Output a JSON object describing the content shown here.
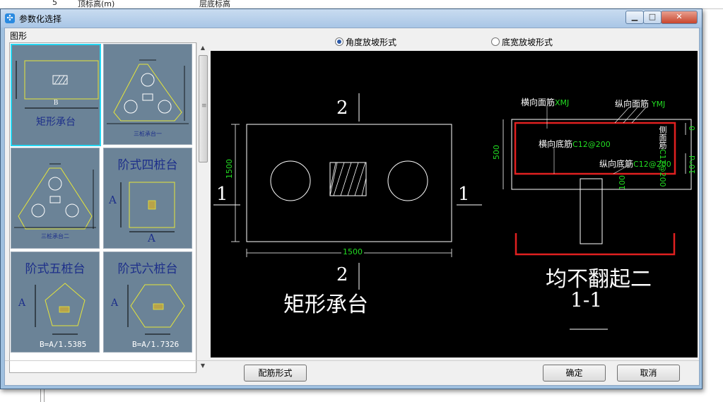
{
  "background_app": {
    "row_number": "5",
    "col1_text": "顶标高(m)",
    "col2_text": "层底标高"
  },
  "window": {
    "title": "参数化选择",
    "minimize_symbol": "▁",
    "maximize_symbol": "□",
    "close_symbol": "✕"
  },
  "left_panel": {
    "label": "图形",
    "thumbnails": [
      {
        "caption": "矩形承台",
        "dim_label": "B"
      },
      {
        "caption": "三桩承台一"
      },
      {
        "caption": "三桩承台二"
      },
      {
        "caption": "阶式四桩台",
        "dim_a": "A",
        "dim_b": "A"
      },
      {
        "caption": "阶式五桩台",
        "dim_a": "A",
        "formula": "B=A/1.5385"
      },
      {
        "caption": "阶式六桩台",
        "dim_a": "A",
        "formula": "B=A/1.7326"
      }
    ]
  },
  "right_panel": {
    "radio_options": [
      {
        "label": "角度放坡形式",
        "selected": true
      },
      {
        "label": "底宽放坡形式",
        "selected": false
      }
    ],
    "drawing": {
      "plan_title": "矩形承台",
      "section_mark_num": "1",
      "section_mark_alt": "2",
      "width_dim": "1500",
      "height_dim": "1500",
      "section_title": "均不翻起二",
      "section_label": "1-1",
      "rebar_top_transverse": "横向面筋",
      "rebar_top_transverse_code": "XMJ",
      "rebar_top_longitudinal": "纵向面筋",
      "rebar_top_longitudinal_code": "YMJ",
      "rebar_bottom_transverse": "横向底筋",
      "rebar_bottom_transverse_code": "C12@200",
      "rebar_bottom_longitudinal": "纵向底筋",
      "rebar_bottom_longitudinal_code": "C12@200",
      "side_rebar": "侧面筋",
      "side_rebar_code": "C12@200",
      "depth_dim": "500",
      "cover_dim": "100",
      "zero_dim": "0",
      "anchor_dim": "10*d"
    }
  },
  "footer": {
    "rebar_form_button": "配筋形式",
    "ok_button": "确定",
    "cancel_button": "取消"
  },
  "colors": {
    "drawing_bg": "#000000",
    "line_white": "#ffffff",
    "rebar_red": "#e02020",
    "annotation_green": "#22dd22",
    "thumb_bg": "#6b8397",
    "thumb_line": "#e6e63a",
    "selection_border": "#26d6f2"
  }
}
